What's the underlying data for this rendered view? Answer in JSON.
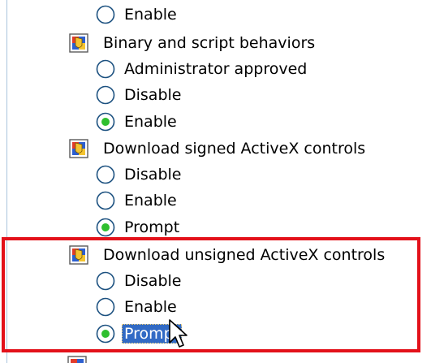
{
  "settings": [
    {
      "title": "",
      "options": [
        {
          "label": "Enable",
          "selected": false
        }
      ]
    },
    {
      "title": "Binary and script behaviors",
      "options": [
        {
          "label": "Administrator approved",
          "selected": false
        },
        {
          "label": "Disable",
          "selected": false
        },
        {
          "label": "Enable",
          "selected": true
        }
      ]
    },
    {
      "title": "Download signed ActiveX controls",
      "options": [
        {
          "label": "Disable",
          "selected": false
        },
        {
          "label": "Enable",
          "selected": false
        },
        {
          "label": "Prompt",
          "selected": true
        }
      ]
    },
    {
      "title": "Download unsigned ActiveX controls",
      "options": [
        {
          "label": "Disable",
          "selected": false
        },
        {
          "label": "Enable",
          "selected": false
        },
        {
          "label": "Prompt",
          "selected": true
        }
      ]
    }
  ],
  "icons": {
    "setting": "security-setting-icon",
    "radio": "radio-button",
    "cursor": "mouse-pointer-icon"
  },
  "colors": {
    "highlight_box": "#e3111a",
    "selection_background": "#316ac5",
    "radio_selected_dot": "#2fbf2f"
  }
}
